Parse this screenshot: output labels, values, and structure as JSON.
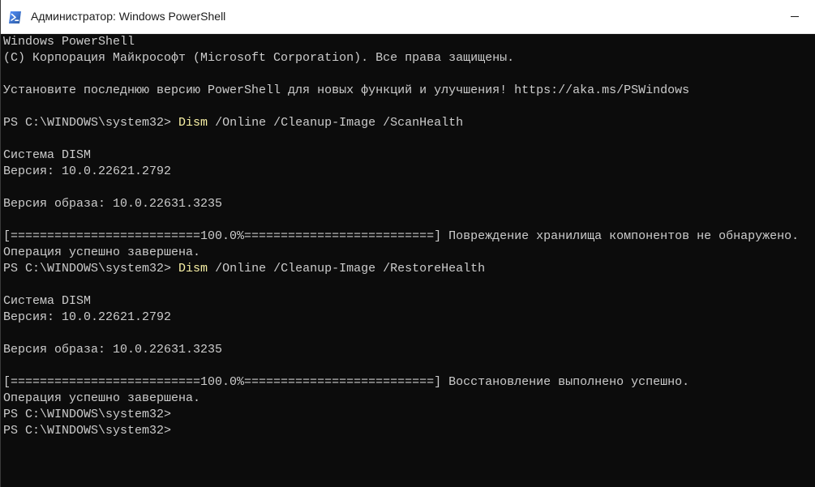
{
  "window": {
    "title": "Администратор: Windows PowerShell",
    "icon": "powershell-icon",
    "colors": {
      "titlebar": "#ffffff",
      "console_bg": "#0c0c0c",
      "console_fg": "#cccccc",
      "command": "#f9f1a5"
    }
  },
  "console": {
    "lines": [
      {
        "text": "Windows PowerShell"
      },
      {
        "text": "(C) Корпорация Майкрософт (Microsoft Corporation). Все права защищены."
      },
      {
        "text": ""
      },
      {
        "text": "Установите последнюю версию PowerShell для новых функций и улучшения! https://aka.ms/PSWindows"
      },
      {
        "text": ""
      },
      {
        "prompt": "PS C:\\WINDOWS\\system32> ",
        "command": "Dism",
        "args": " /Online /Cleanup-Image /ScanHealth"
      },
      {
        "text": ""
      },
      {
        "text": "Система DISM"
      },
      {
        "text": "Версия: 10.0.22621.2792"
      },
      {
        "text": ""
      },
      {
        "text": "Версия образа: 10.0.22631.3235"
      },
      {
        "text": ""
      },
      {
        "text": "[==========================100.0%==========================] Повреждение хранилища компонентов не обнаружено."
      },
      {
        "text": "Операция успешно завершена."
      },
      {
        "prompt": "PS C:\\WINDOWS\\system32> ",
        "command": "Dism",
        "args": " /Online /Cleanup-Image /RestoreHealth"
      },
      {
        "text": ""
      },
      {
        "text": "Система DISM"
      },
      {
        "text": "Версия: 10.0.22621.2792"
      },
      {
        "text": ""
      },
      {
        "text": "Версия образа: 10.0.22631.3235"
      },
      {
        "text": ""
      },
      {
        "text": "[==========================100.0%==========================] Восстановление выполнено успешно."
      },
      {
        "text": "Операция успешно завершена."
      },
      {
        "text": "PS C:\\WINDOWS\\system32>"
      },
      {
        "text": "PS C:\\WINDOWS\\system32>"
      }
    ]
  }
}
